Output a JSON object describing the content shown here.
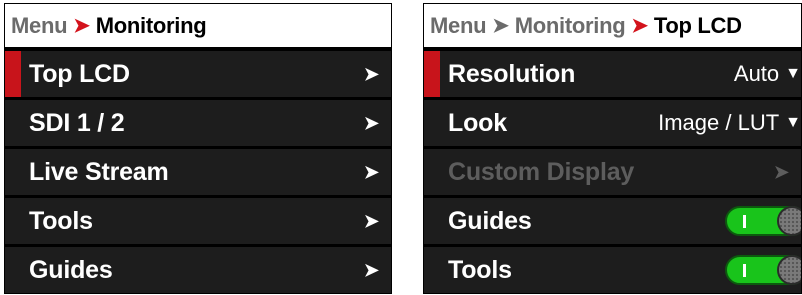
{
  "left": {
    "breadcrumb": {
      "root": "Menu",
      "current": "Monitoring"
    },
    "items": [
      {
        "label": "Top LCD",
        "selected": true
      },
      {
        "label": "SDI 1 / 2"
      },
      {
        "label": "Live Stream"
      },
      {
        "label": "Tools"
      },
      {
        "label": "Guides"
      }
    ],
    "chevron": "›"
  },
  "right": {
    "breadcrumb": {
      "root": "Menu",
      "middle": "Monitoring",
      "current": "Top LCD"
    },
    "items": [
      {
        "label": "Resolution",
        "value": "Auto",
        "selected": true
      },
      {
        "label": "Look",
        "value": "Image / LUT"
      },
      {
        "label": "Custom Display",
        "disabled": true
      },
      {
        "label": "Guides",
        "toggle": "on"
      },
      {
        "label": "Tools",
        "toggle": "on"
      }
    ],
    "dropdown_caret": "⌄",
    "chevron": "›"
  },
  "colors": {
    "accent": "#c8141b",
    "toggle_on": "#19c41b",
    "row_bg": "#1d1d1d",
    "disabled_text": "#5d5d5d"
  }
}
